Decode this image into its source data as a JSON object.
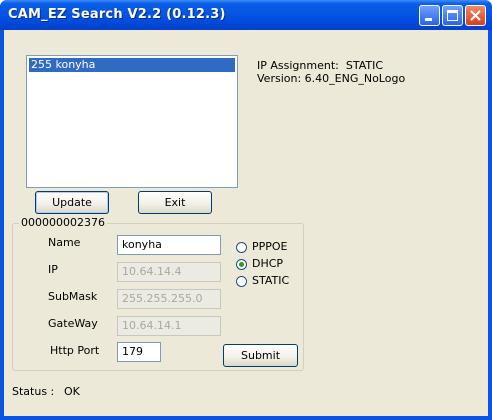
{
  "window": {
    "title": "CAM_EZ Search V2.2 (0.12.3)"
  },
  "device_list": {
    "items": [
      "255 konyha"
    ],
    "selected_index": 0
  },
  "info": {
    "ip_assignment_label": "IP Assignment:",
    "ip_assignment_value": "STATIC",
    "version_label": "Version:",
    "version_value": "6.40_ENG_NoLogo"
  },
  "buttons": {
    "update": "Update",
    "exit": "Exit",
    "submit": "Submit"
  },
  "device_group": {
    "caption": "000000002376",
    "name_label": "Name",
    "name_value": "konyha",
    "ip_label": "IP",
    "ip_value": "10.64.14.4",
    "submask_label": "SubMask",
    "submask_value": "255.255.255.0",
    "gateway_label": "GateWay",
    "gateway_value": "10.64.14.1",
    "http_port_label": "Http Port",
    "http_port_value": "179"
  },
  "mode": {
    "options": [
      "PPPOE",
      "DHCP",
      "STATIC"
    ],
    "selected": "DHCP"
  },
  "status": {
    "label": "Status :",
    "value": "OK"
  },
  "colors": {
    "titlebar": "#0554e3",
    "selection": "#316ac5",
    "radio_dot": "#21a121"
  }
}
